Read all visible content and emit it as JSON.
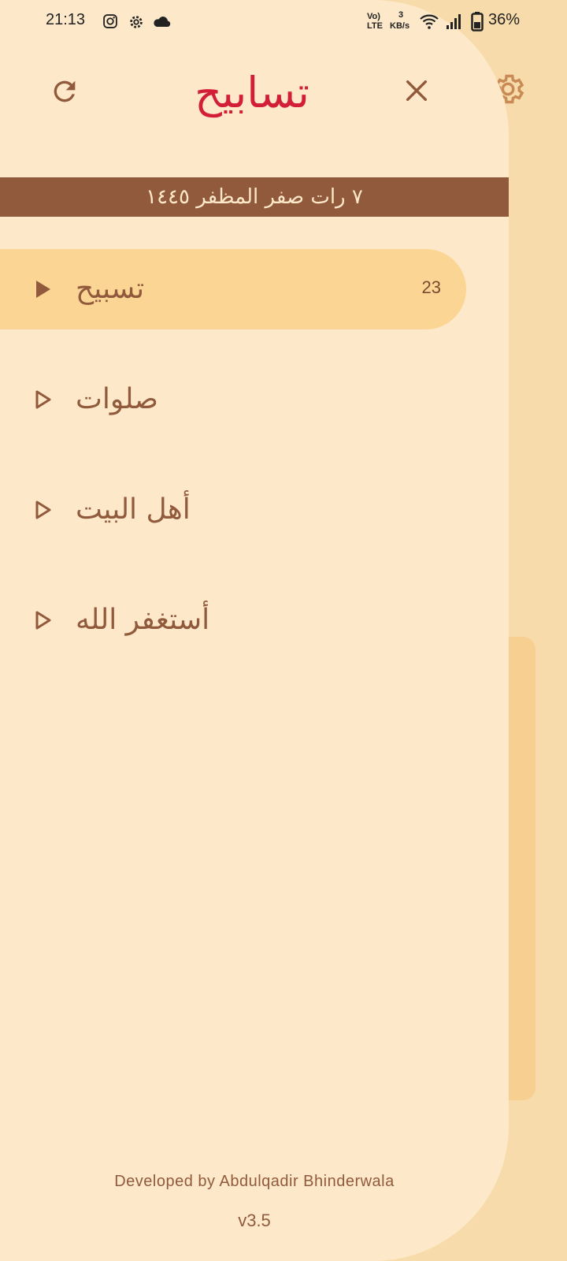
{
  "status_bar": {
    "time": "21:13",
    "volte_top": "Vo)",
    "volte_bottom": "LTE",
    "speed_value": "3",
    "speed_unit": "KB/s",
    "battery": "36%"
  },
  "header": {
    "title": "تسابيح",
    "refresh_icon": "refresh-icon",
    "close_icon": "close-icon",
    "settings_icon": "gear-icon"
  },
  "date_banner": "٧ رات  صفر المظفر ١٤٤٥",
  "menu": [
    {
      "label": "تسبيح",
      "count": "23",
      "active": true
    },
    {
      "label": "صلوات",
      "count": "",
      "active": false
    },
    {
      "label": "أهل البيت",
      "count": "",
      "active": false
    },
    {
      "label": "أستغفر الله",
      "count": "",
      "active": false
    }
  ],
  "footer": {
    "developer": "Developed by Abdulqadir Bhinderwala",
    "version": "v3.5"
  },
  "colors": {
    "drawer_bg": "#fde9c9",
    "app_bg": "#f7dbab",
    "accent_red": "#d21e37",
    "brown": "#915a3c",
    "active_item": "#fbd594"
  }
}
